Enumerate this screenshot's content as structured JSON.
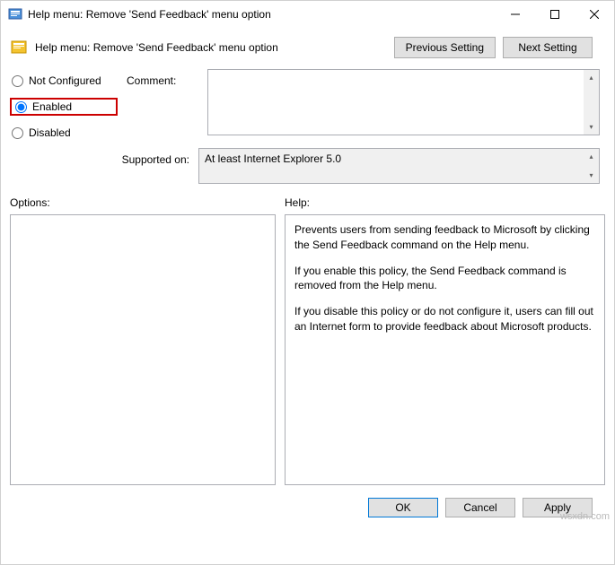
{
  "window": {
    "title": "Help menu: Remove 'Send Feedback' menu option"
  },
  "header": {
    "title": "Help menu: Remove 'Send Feedback' menu option",
    "prev": "Previous Setting",
    "next": "Next Setting"
  },
  "config": {
    "not_configured": "Not Configured",
    "enabled": "Enabled",
    "disabled": "Disabled",
    "selected": "enabled"
  },
  "comment": {
    "label": "Comment:",
    "value": ""
  },
  "supported": {
    "label": "Supported on:",
    "value": "At least Internet Explorer 5.0"
  },
  "options": {
    "label": "Options:"
  },
  "help": {
    "label": "Help:",
    "p1": "Prevents users from sending feedback to Microsoft by clicking the Send Feedback command on the Help menu.",
    "p2": "If you enable this policy, the Send Feedback command is removed from the Help menu.",
    "p3": "If you disable this policy or do not configure it, users can fill out an Internet form to provide feedback about Microsoft products."
  },
  "footer": {
    "ok": "OK",
    "cancel": "Cancel",
    "apply": "Apply"
  },
  "watermark": "wsxdn.com"
}
